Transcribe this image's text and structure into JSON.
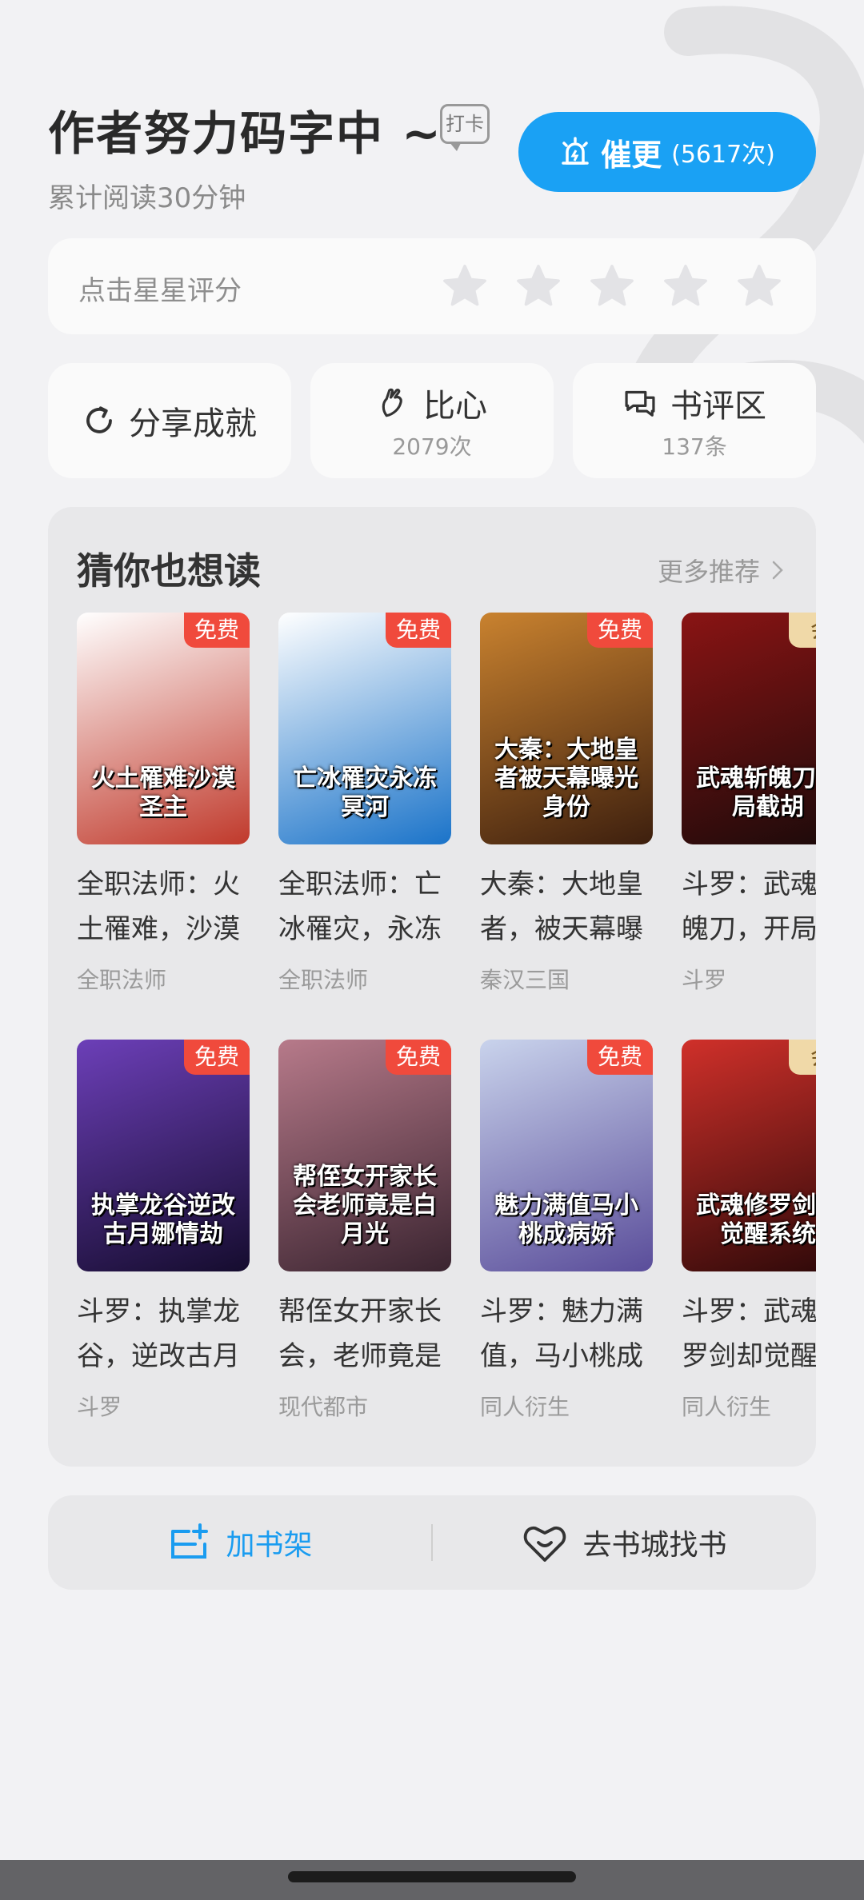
{
  "header": {
    "title": "作者努力码字中 ~",
    "checkin_tag": "打卡",
    "read_time": "累计阅读30分钟",
    "urge_label": "催更",
    "urge_count": "(5617次)"
  },
  "rating": {
    "label": "点击星星评分",
    "stars": 5
  },
  "actions": {
    "share_label": "分享成就",
    "heart_label": "比心",
    "heart_count": "2079次",
    "review_label": "书评区",
    "review_count": "137条"
  },
  "recommend": {
    "title": "猜你也想读",
    "more": "更多推荐",
    "books": [
      {
        "title": "全职法师：火土罹难，沙漠",
        "category": "全职法师",
        "badge": "免费",
        "cover_text": "火土罹难沙漠圣主",
        "c1": "#ffffff",
        "c2": "#c0392b"
      },
      {
        "title": "全职法师：亡冰罹灾，永冻",
        "category": "全职法师",
        "badge": "免费",
        "cover_text": "亡冰罹灾永冻冥河",
        "c1": "#ffffff",
        "c2": "#1a73c9"
      },
      {
        "title": "大秦：大地皇者，被天幕曝",
        "category": "秦汉三国",
        "badge": "免费",
        "cover_text": "大秦：大地皇者被天幕曝光身份",
        "c1": "#c9822f",
        "c2": "#3d1f0e"
      },
      {
        "title": "斗罗：武魂斩魄刀，开局",
        "category": "斗罗",
        "badge": "会",
        "cover_text": "武魂斩魄刀开局截胡",
        "c1": "#8a1414",
        "c2": "#1a0a0a"
      },
      {
        "title": "斗罗：执掌龙谷，逆改古月",
        "category": "斗罗",
        "badge": "免费",
        "cover_text": "执掌龙谷逆改古月娜情劫",
        "c1": "#6c3fb8",
        "c2": "#150c2e"
      },
      {
        "title": "帮侄女开家长会，老师竟是",
        "category": "现代都市",
        "badge": "免费",
        "cover_text": "帮侄女开家长会老师竟是白月光",
        "c1": "#b77a8a",
        "c2": "#3a2430"
      },
      {
        "title": "斗罗：魅力满值，马小桃成",
        "category": "同人衍生",
        "badge": "免费",
        "cover_text": "魅力满值马小桃成病娇",
        "c1": "#c9d3ec",
        "c2": "#5a4d9a"
      },
      {
        "title": "斗罗：武魂修罗剑却觉醒",
        "category": "同人衍生",
        "badge": "会",
        "cover_text": "武魂修罗剑却觉醒系统",
        "c1": "#d0302a",
        "c2": "#2a0808"
      }
    ]
  },
  "bottom": {
    "shelf_label": "加书架",
    "store_label": "去书城找书"
  },
  "colors": {
    "accent": "#1aa1f4",
    "badge_free": "#f04a3c",
    "badge_member": "#f0d9a8"
  }
}
